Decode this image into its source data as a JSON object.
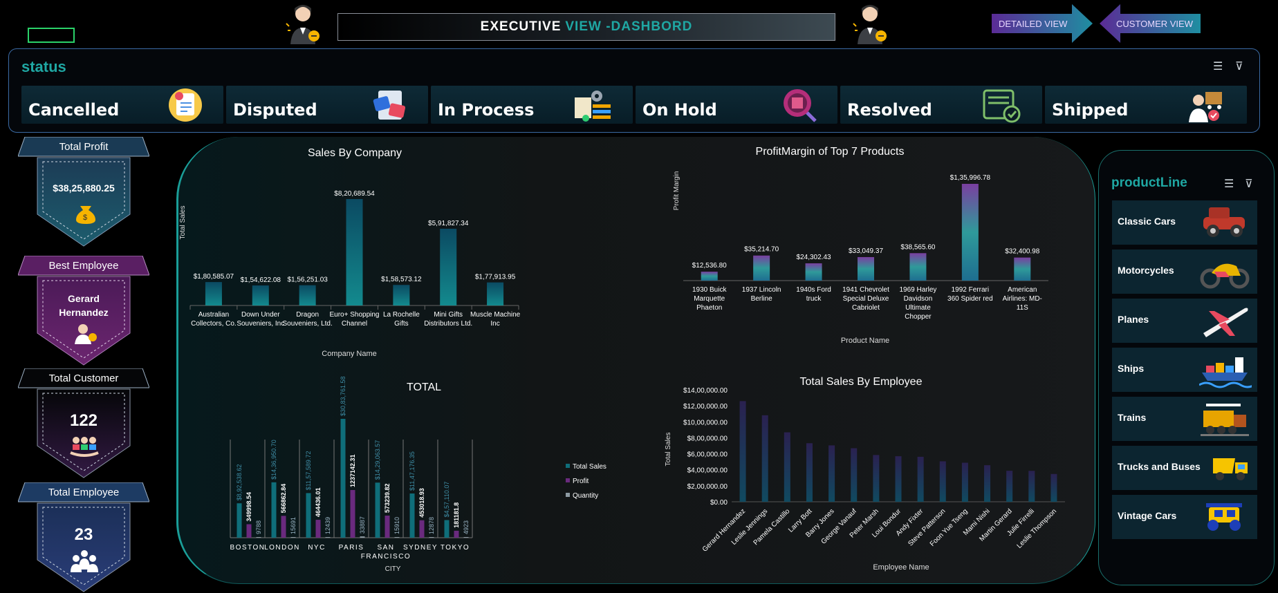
{
  "header": {
    "title_part1": "EXECUTIVE",
    "title_part2": "VIEW -DASHBORD",
    "detailed_view": "DETAILED VIEW",
    "customer_view": "CUSTOMER VIEW"
  },
  "status": {
    "title": "status",
    "items": [
      {
        "label": "Cancelled",
        "icon": "cancelled-document-icon"
      },
      {
        "label": "Disputed",
        "icon": "disputed-cards-icon"
      },
      {
        "label": "In Process",
        "icon": "process-gear-icon"
      },
      {
        "label": "On Hold",
        "icon": "magnifier-box-icon"
      },
      {
        "label": "Resolved",
        "icon": "resolved-screen-icon"
      },
      {
        "label": "Shipped",
        "icon": "delivery-truck-icon"
      }
    ]
  },
  "kpis": {
    "total_profit": {
      "label": "Total Profit",
      "value": "$38,25,880.25"
    },
    "best_employee": {
      "label": "Best Employee",
      "value_line1": "Gerard",
      "value_line2": "Hernandez"
    },
    "total_customer": {
      "label": "Total Customer",
      "value": "122"
    },
    "total_employee": {
      "label": "Total Employee",
      "value": "23"
    }
  },
  "product_line": {
    "title": "productLine",
    "items": [
      {
        "label": "Classic Cars",
        "icon": "classic-car-icon"
      },
      {
        "label": "Motorcycles",
        "icon": "motorcycle-icon"
      },
      {
        "label": "Planes",
        "icon": "plane-icon"
      },
      {
        "label": "Ships",
        "icon": "ship-icon"
      },
      {
        "label": "Trains",
        "icon": "train-icon"
      },
      {
        "label": "Trucks and Buses",
        "icon": "truck-icon"
      },
      {
        "label": "Vintage Cars",
        "icon": "vintage-car-icon"
      }
    ]
  },
  "colors": {
    "accent": "#1fa7a3",
    "teal": "#0f6e7a",
    "purple": "#6a2a7e",
    "grey": "#8d9aa2"
  },
  "chart_data": [
    {
      "id": "sales_by_company",
      "type": "bar",
      "title": "Sales By Company",
      "xlabel": "Company Name",
      "ylabel": "Total Sales",
      "categories": [
        [
          "Australian",
          "Collectors, Co."
        ],
        [
          "Down Under",
          "Souveniers, Inc"
        ],
        [
          "Dragon",
          "Souveniers, Ltd."
        ],
        [
          "Euro+ Shopping",
          "Channel"
        ],
        [
          "La Rochelle",
          "Gifts"
        ],
        [
          "Mini Gifts",
          "Distributors Ltd."
        ],
        [
          "Muscle Machine",
          "Inc"
        ]
      ],
      "values": [
        180585.07,
        154622.08,
        156251.03,
        820689.54,
        158573.12,
        591827.34,
        177913.95
      ],
      "data_labels": [
        "$1,80,585.07",
        "$1,54,622.08",
        "$1,56,251.03",
        "$8,20,689.54",
        "$1,58,573.12",
        "$5,91,827.34",
        "$1,77,913.95"
      ]
    },
    {
      "id": "profit_margin_top7",
      "type": "bar",
      "title": "ProfitMargin of Top 7 Products",
      "xlabel": "Product Name",
      "ylabel": "Profit Margin",
      "categories": [
        [
          "1930 Buick",
          "Marquette",
          "Phaeton"
        ],
        [
          "1937 Lincoln",
          "Berline"
        ],
        [
          "1940s Ford",
          "truck"
        ],
        [
          "1941 Chevrolet",
          "Special Deluxe",
          "Cabriolet"
        ],
        [
          "1969 Harley",
          "Davidson",
          "Ultimate",
          "Chopper"
        ],
        [
          "1992 Ferrari",
          "360 Spider red"
        ],
        [
          "American",
          "Airlines: MD-",
          "11S"
        ]
      ],
      "values": [
        12536.8,
        35214.7,
        24302.43,
        33049.37,
        38565.6,
        135996.78,
        32400.98
      ],
      "data_labels": [
        "$12,536.80",
        "$35,214.70",
        "$24,302.43",
        "$33,049.37",
        "$38,565.60",
        "$1,35,996.78",
        "$32,400.98"
      ]
    },
    {
      "id": "total_by_city",
      "type": "bar",
      "title": "TOTAL",
      "xlabel": "CITY",
      "ylabel": "",
      "categories": [
        [
          "BOSTON"
        ],
        [
          "LONDON"
        ],
        [
          "NYC"
        ],
        [
          "PARIS"
        ],
        [
          "SAN",
          "FRANCISCO"
        ],
        [
          "SYDNEY"
        ],
        [
          "TOKYO"
        ]
      ],
      "series": [
        {
          "name": "Total Sales",
          "values": [
            892538.62,
            1436950.7,
            1157589.72,
            3083761.58,
            1429063.57,
            1147176.35,
            457110.07
          ],
          "data_labels": [
            "$8,92,538.62",
            "$14,36,950.70",
            "$11,57,589.72",
            "$30,83,761.58",
            "$14,29,063.57",
            "$11,47,176.35",
            "$4,57,110.07"
          ]
        },
        {
          "name": "Profit",
          "values": [
            349998.54,
            566862.84,
            464436.01,
            1237142.31,
            573239.82,
            453018.93,
            181181.8
          ],
          "data_labels": [
            "349998.54",
            "566862.84",
            "464436.01",
            "1237142.31",
            "573239.82",
            "453018.93",
            "181181.8"
          ]
        },
        {
          "name": "Quantity",
          "values": [
            9788,
            15691,
            12439,
            33887,
            15910,
            12878,
            4923
          ],
          "data_labels": [
            "9788",
            "15691",
            "12439",
            "33887",
            "15910",
            "12878",
            "4923"
          ]
        }
      ],
      "legend": "right"
    },
    {
      "id": "sales_by_employee",
      "type": "bar",
      "title": "Total Sales By Employee",
      "xlabel": "Employee Name",
      "ylabel": "Total Sales",
      "categories": [
        "Gerard Hernandez",
        "Leslie Jennings",
        "Pamela Castillo",
        "Larry Bott",
        "Barry Jones",
        "George Vanauf",
        "Peter Marsh",
        "Loui Bondur",
        "Andy Fixter",
        "Steve Patterson",
        "Foon Yue Tseng",
        "Mami Nishi",
        "Martin Gerard",
        "Julie Firrelli",
        "Leslie Thompson"
      ],
      "values": [
        1258577.81,
        1081530.54,
        868220.55,
        732096.79,
        704853.91,
        669377.05,
        584593.76,
        569485.75,
        562582.59,
        505875.42,
        488212.67,
        457110.07,
        387477.47,
        386663.2,
        347533.03
      ],
      "ylim": [
        0,
        1400000
      ],
      "yticks": [
        "$0.00",
        "$2,00,000.00",
        "$4,00,000.00",
        "$6,00,000.00",
        "$8,00,000.00",
        "$10,00,000.00",
        "$12,00,000.00",
        "$14,00,000.00"
      ]
    }
  ]
}
